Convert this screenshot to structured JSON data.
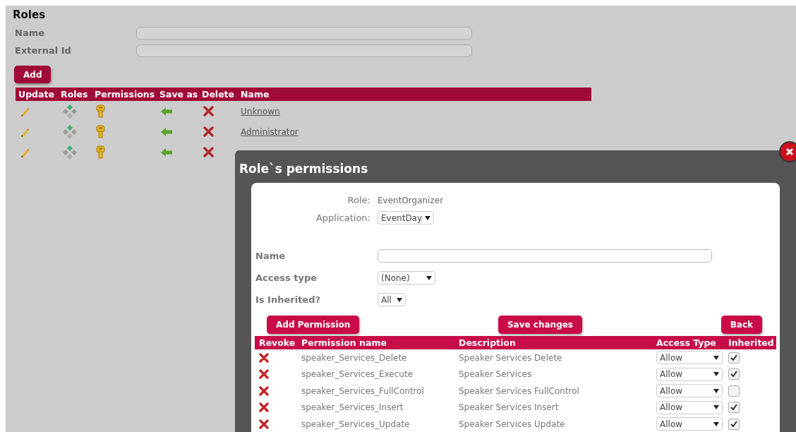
{
  "page": {
    "title": "Roles"
  },
  "form": {
    "fields": [
      {
        "label": "Name"
      },
      {
        "label": "External Id"
      }
    ],
    "add_button": "Add"
  },
  "roles_table": {
    "columns": [
      "Update",
      "Roles",
      "Permissions",
      "Save as",
      "Delete",
      "Name"
    ],
    "rows": [
      {
        "name": "Unknown"
      },
      {
        "name": "Administrator"
      },
      {}
    ]
  },
  "dialog": {
    "title": "Role`s permissions",
    "role_label": "Role:",
    "role_value": "EventOrganizer",
    "application_label": "Application:",
    "application_value": "EventDay",
    "filters": [
      {
        "label": "Name",
        "kind": "text"
      },
      {
        "label": "Access type",
        "kind": "select",
        "value": "(None)"
      },
      {
        "label": "Is Inherited?",
        "kind": "select",
        "value": "All"
      }
    ],
    "buttons": [
      "Add Permission",
      "Save changes",
      "Back"
    ],
    "table": {
      "columns": [
        "Revoke",
        "Permission name",
        "Description",
        "Access Type",
        "Inherited"
      ],
      "rows": [
        {
          "name": "speaker_Services_Delete",
          "description": "Speaker Services Delete",
          "access_type": "Allow",
          "inherited": true
        },
        {
          "name": "speaker_Services_Execute",
          "description": "Speaker Services",
          "access_type": "Allow",
          "inherited": true
        },
        {
          "name": "speaker_Services_FullControl",
          "description": "Speaker Services FullControl",
          "access_type": "Allow",
          "inherited": false
        },
        {
          "name": "speaker_Services_Insert",
          "description": "Speaker Services Insert",
          "access_type": "Allow",
          "inherited": true
        },
        {
          "name": "speaker_Services_Update",
          "description": "Speaker Services Update",
          "access_type": "Allow",
          "inherited": true
        }
      ]
    }
  }
}
